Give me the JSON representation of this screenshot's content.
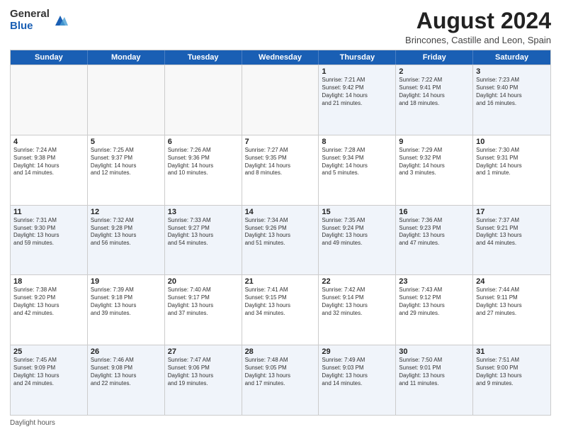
{
  "logo": {
    "general": "General",
    "blue": "Blue"
  },
  "title": "August 2024",
  "subtitle": "Brincones, Castille and Leon, Spain",
  "days": [
    "Sunday",
    "Monday",
    "Tuesday",
    "Wednesday",
    "Thursday",
    "Friday",
    "Saturday"
  ],
  "rows": [
    [
      {
        "day": "",
        "info": ""
      },
      {
        "day": "",
        "info": ""
      },
      {
        "day": "",
        "info": ""
      },
      {
        "day": "",
        "info": ""
      },
      {
        "day": "1",
        "info": "Sunrise: 7:21 AM\nSunset: 9:42 PM\nDaylight: 14 hours\nand 21 minutes."
      },
      {
        "day": "2",
        "info": "Sunrise: 7:22 AM\nSunset: 9:41 PM\nDaylight: 14 hours\nand 18 minutes."
      },
      {
        "day": "3",
        "info": "Sunrise: 7:23 AM\nSunset: 9:40 PM\nDaylight: 14 hours\nand 16 minutes."
      }
    ],
    [
      {
        "day": "4",
        "info": "Sunrise: 7:24 AM\nSunset: 9:38 PM\nDaylight: 14 hours\nand 14 minutes."
      },
      {
        "day": "5",
        "info": "Sunrise: 7:25 AM\nSunset: 9:37 PM\nDaylight: 14 hours\nand 12 minutes."
      },
      {
        "day": "6",
        "info": "Sunrise: 7:26 AM\nSunset: 9:36 PM\nDaylight: 14 hours\nand 10 minutes."
      },
      {
        "day": "7",
        "info": "Sunrise: 7:27 AM\nSunset: 9:35 PM\nDaylight: 14 hours\nand 8 minutes."
      },
      {
        "day": "8",
        "info": "Sunrise: 7:28 AM\nSunset: 9:34 PM\nDaylight: 14 hours\nand 5 minutes."
      },
      {
        "day": "9",
        "info": "Sunrise: 7:29 AM\nSunset: 9:32 PM\nDaylight: 14 hours\nand 3 minutes."
      },
      {
        "day": "10",
        "info": "Sunrise: 7:30 AM\nSunset: 9:31 PM\nDaylight: 14 hours\nand 1 minute."
      }
    ],
    [
      {
        "day": "11",
        "info": "Sunrise: 7:31 AM\nSunset: 9:30 PM\nDaylight: 13 hours\nand 59 minutes."
      },
      {
        "day": "12",
        "info": "Sunrise: 7:32 AM\nSunset: 9:28 PM\nDaylight: 13 hours\nand 56 minutes."
      },
      {
        "day": "13",
        "info": "Sunrise: 7:33 AM\nSunset: 9:27 PM\nDaylight: 13 hours\nand 54 minutes."
      },
      {
        "day": "14",
        "info": "Sunrise: 7:34 AM\nSunset: 9:26 PM\nDaylight: 13 hours\nand 51 minutes."
      },
      {
        "day": "15",
        "info": "Sunrise: 7:35 AM\nSunset: 9:24 PM\nDaylight: 13 hours\nand 49 minutes."
      },
      {
        "day": "16",
        "info": "Sunrise: 7:36 AM\nSunset: 9:23 PM\nDaylight: 13 hours\nand 47 minutes."
      },
      {
        "day": "17",
        "info": "Sunrise: 7:37 AM\nSunset: 9:21 PM\nDaylight: 13 hours\nand 44 minutes."
      }
    ],
    [
      {
        "day": "18",
        "info": "Sunrise: 7:38 AM\nSunset: 9:20 PM\nDaylight: 13 hours\nand 42 minutes."
      },
      {
        "day": "19",
        "info": "Sunrise: 7:39 AM\nSunset: 9:18 PM\nDaylight: 13 hours\nand 39 minutes."
      },
      {
        "day": "20",
        "info": "Sunrise: 7:40 AM\nSunset: 9:17 PM\nDaylight: 13 hours\nand 37 minutes."
      },
      {
        "day": "21",
        "info": "Sunrise: 7:41 AM\nSunset: 9:15 PM\nDaylight: 13 hours\nand 34 minutes."
      },
      {
        "day": "22",
        "info": "Sunrise: 7:42 AM\nSunset: 9:14 PM\nDaylight: 13 hours\nand 32 minutes."
      },
      {
        "day": "23",
        "info": "Sunrise: 7:43 AM\nSunset: 9:12 PM\nDaylight: 13 hours\nand 29 minutes."
      },
      {
        "day": "24",
        "info": "Sunrise: 7:44 AM\nSunset: 9:11 PM\nDaylight: 13 hours\nand 27 minutes."
      }
    ],
    [
      {
        "day": "25",
        "info": "Sunrise: 7:45 AM\nSunset: 9:09 PM\nDaylight: 13 hours\nand 24 minutes."
      },
      {
        "day": "26",
        "info": "Sunrise: 7:46 AM\nSunset: 9:08 PM\nDaylight: 13 hours\nand 22 minutes."
      },
      {
        "day": "27",
        "info": "Sunrise: 7:47 AM\nSunset: 9:06 PM\nDaylight: 13 hours\nand 19 minutes."
      },
      {
        "day": "28",
        "info": "Sunrise: 7:48 AM\nSunset: 9:05 PM\nDaylight: 13 hours\nand 17 minutes."
      },
      {
        "day": "29",
        "info": "Sunrise: 7:49 AM\nSunset: 9:03 PM\nDaylight: 13 hours\nand 14 minutes."
      },
      {
        "day": "30",
        "info": "Sunrise: 7:50 AM\nSunset: 9:01 PM\nDaylight: 13 hours\nand 11 minutes."
      },
      {
        "day": "31",
        "info": "Sunrise: 7:51 AM\nSunset: 9:00 PM\nDaylight: 13 hours\nand 9 minutes."
      }
    ]
  ],
  "footer": "Daylight hours"
}
